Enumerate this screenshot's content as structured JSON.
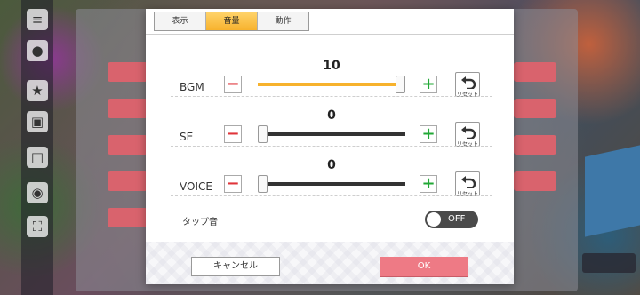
{
  "tabs": [
    {
      "label": "表示",
      "active": false
    },
    {
      "label": "音量",
      "active": true
    },
    {
      "label": "動作",
      "active": false
    }
  ],
  "sliders": {
    "bgm": {
      "label": "BGM",
      "value": "10",
      "max": 10
    },
    "se": {
      "label": "SE",
      "value": "0",
      "max": 10
    },
    "voice": {
      "label": "VOICE",
      "value": "0",
      "max": 10
    }
  },
  "controls": {
    "minus": "−",
    "plus": "+",
    "reset_label": "リセット"
  },
  "tap_sound": {
    "label": "タップ音",
    "state": "OFF"
  },
  "footer": {
    "cancel_label": "キャンセル",
    "ok_label": "OK"
  },
  "colors": {
    "accent": "#f7b22d",
    "minus": "#e0343a",
    "plus": "#22a836",
    "ok": "#ee7a85"
  }
}
